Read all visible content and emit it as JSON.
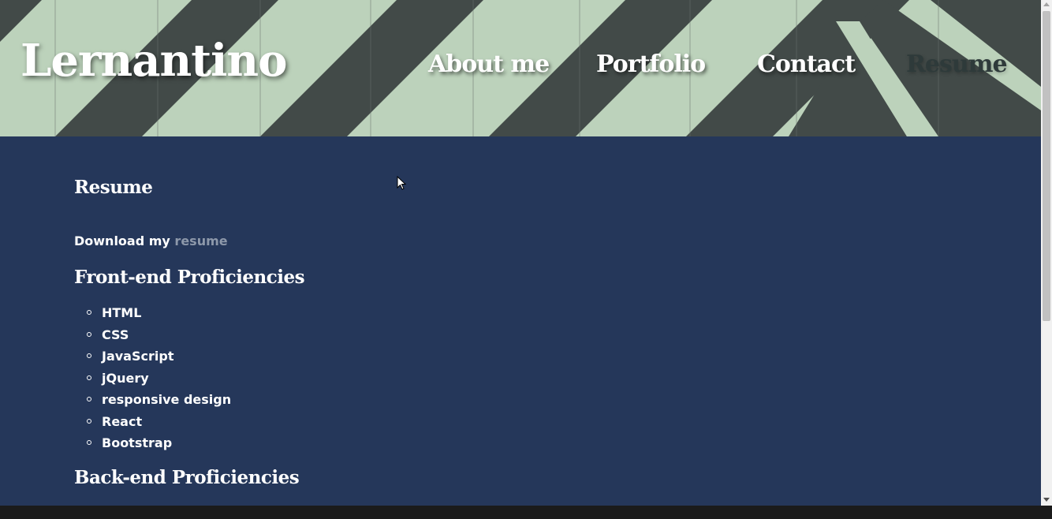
{
  "site": {
    "brand": "Lernantino"
  },
  "nav": {
    "items": [
      {
        "label": "About me",
        "active": false
      },
      {
        "label": "Portfolio",
        "active": false
      },
      {
        "label": "Contact",
        "active": false
      },
      {
        "label": "Resume",
        "active": true
      }
    ]
  },
  "main": {
    "resume_heading": "Resume",
    "download_prefix": "Download my",
    "download_link": "resume",
    "frontend_heading": "Front-end Proficiencies",
    "frontend_skills": [
      "HTML",
      "CSS",
      "JavaScript",
      "jQuery",
      "responsive design",
      "React",
      "Bootstrap"
    ],
    "backend_heading": "Back-end Proficiencies"
  },
  "colors": {
    "content_bg": "#25375a",
    "stripe_light": "#bcd2bb",
    "stripe_dark": "#424a48",
    "link": "#8d98aa",
    "active_nav": "#2e3a3a"
  }
}
